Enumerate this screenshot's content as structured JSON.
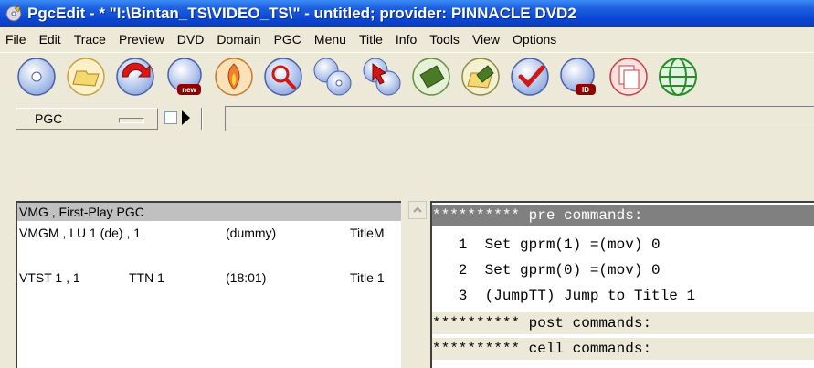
{
  "window": {
    "title": "PgcEdit - * \"I:\\Bintan_TS\\VIDEO_TS\\\" - untitled; provider: PINNACLE DVD2"
  },
  "menu": [
    "File",
    "Edit",
    "Trace",
    "Preview",
    "DVD",
    "Domain",
    "PGC",
    "Menu",
    "Title",
    "Info",
    "Tools",
    "View",
    "Options"
  ],
  "toolbar": {
    "icons": [
      "open-disc-icon",
      "open-folder-icon",
      "reload-icon",
      "new-disc-icon",
      "burn-icon",
      "search-icon",
      "disc-link-icon",
      "disc-pointer-icon",
      "save-icon",
      "save-as-icon",
      "check-icon",
      "disc-id-icon",
      "copy-icon",
      "globe-icon"
    ]
  },
  "pgc_bar": {
    "combo_label": "PGC"
  },
  "tree": {
    "rows": [
      {
        "col1": "VMG , First-Play PGC",
        "col2": "",
        "col3": "",
        "col4": ""
      },
      {
        "col1": "VMGM , LU 1 (de) , 1",
        "col2": "",
        "col3": "(dummy)",
        "col4": "TitleM"
      },
      {
        "col1": "VTST 1 , 1",
        "col2": "TTN 1",
        "col3": "(18:01)",
        "col4": "Title 1"
      }
    ]
  },
  "commands": {
    "lines": [
      {
        "kind": "hdr-pre",
        "text": "********** pre commands:"
      },
      {
        "kind": "body",
        "text": "   1  Set gprm(1) =(mov) 0"
      },
      {
        "kind": "body",
        "text": "   2  Set gprm(0) =(mov) 0"
      },
      {
        "kind": "body",
        "text": "   3  (JumpTT) Jump to Title 1"
      },
      {
        "kind": "hdr",
        "text": "********** post commands:"
      },
      {
        "kind": "hdr",
        "text": "********** cell commands:"
      }
    ]
  },
  "colors": {
    "titlebar": "#0a46d4",
    "selection": "#c0c0c0",
    "pre_header": "#808080",
    "panel_bg": "#ece9d8"
  }
}
